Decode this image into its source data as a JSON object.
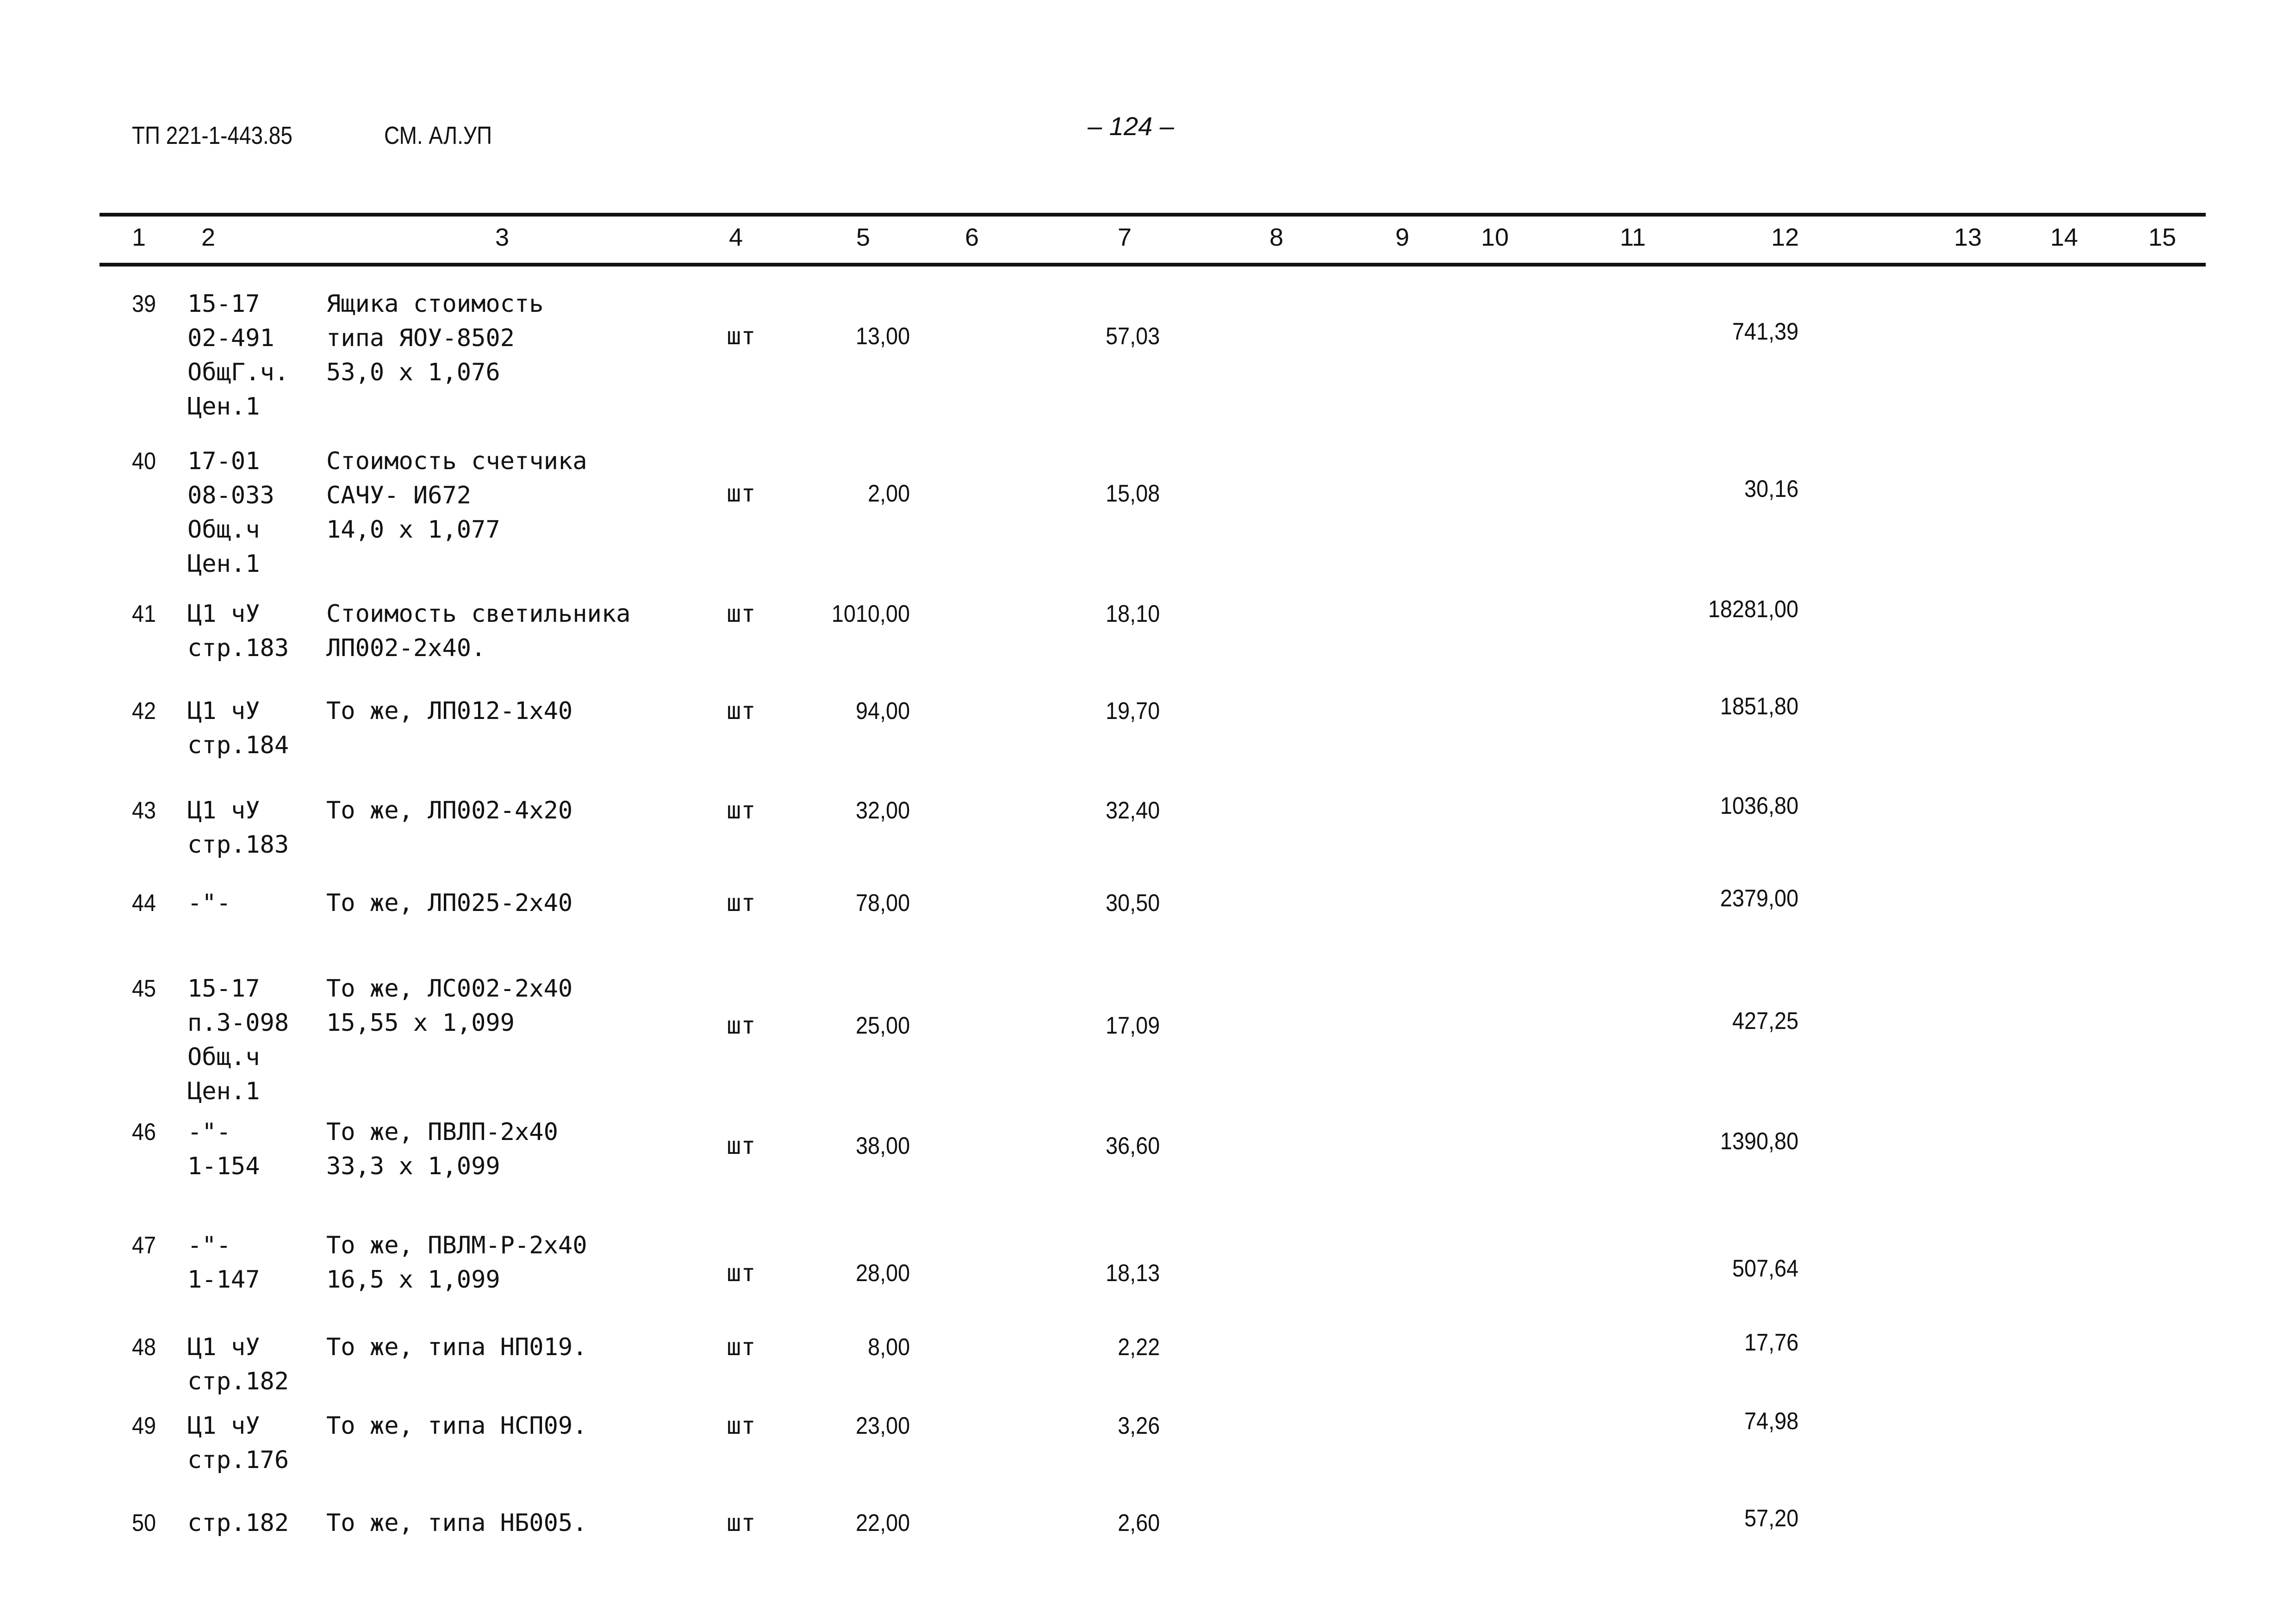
{
  "header": {
    "doc_code": "ТП 221-1-443.85",
    "sheet_ref": "СМ. АЛ.УП",
    "page_number": "– 124 –"
  },
  "columns": [
    "1",
    "2",
    "3",
    "4",
    "5",
    "6",
    "7",
    "8",
    "9",
    "10",
    "11",
    "12",
    "13",
    "14",
    "15"
  ],
  "rows": [
    {
      "no": "39",
      "code": [
        "15-17",
        "02-491",
        "ОбщГ.ч.",
        "Цен.1"
      ],
      "name": [
        "Ящика стоимость",
        "типа ЯОУ-8502",
        "53,0 х 1,076"
      ],
      "unit": "шт",
      "qty": "13,00",
      "price": "57,03",
      "total": "741,39"
    },
    {
      "no": "40",
      "code": [
        "17-01",
        "08-033",
        "Общ.ч",
        "Цен.1"
      ],
      "name": [
        "Стоимость счетчика",
        "САЧУ- И672",
        "14,0 х 1,077"
      ],
      "unit": "шт",
      "qty": "2,00",
      "price": "15,08",
      "total": "30,16"
    },
    {
      "no": "41",
      "code": [
        "Ц1 чУ",
        "стр.183"
      ],
      "name": [
        "Стоимость светильника",
        "ЛП002-2х40."
      ],
      "unit": "шт",
      "qty": "1010,00",
      "price": "18,10",
      "total": "18281,00"
    },
    {
      "no": "42",
      "code": [
        "Ц1 чУ",
        "стр.184"
      ],
      "name": [
        "То же, ЛП012-1х40"
      ],
      "unit": "шт",
      "qty": "94,00",
      "price": "19,70",
      "total": "1851,80"
    },
    {
      "no": "43",
      "code": [
        "Ц1 чУ",
        "стр.183"
      ],
      "name": [
        "То же, ЛП002-4х20"
      ],
      "unit": "шт",
      "qty": "32,00",
      "price": "32,40",
      "total": "1036,80"
    },
    {
      "no": "44",
      "code": [
        "-\"-"
      ],
      "name": [
        "То же, ЛП025-2х40"
      ],
      "unit": "шт",
      "qty": "78,00",
      "price": "30,50",
      "total": "2379,00"
    },
    {
      "no": "45",
      "code": [
        "15-17",
        "п.3-098",
        "Общ.ч",
        "Цен.1"
      ],
      "name": [
        "То же, ЛС002-2х40",
        "15,55 х 1,099"
      ],
      "unit": "шт",
      "qty": "25,00",
      "price": "17,09",
      "total": "427,25"
    },
    {
      "no": "46",
      "code": [
        "-\"-",
        "1-154"
      ],
      "name": [
        "То же, ПВЛП-2х40",
        "33,3 х 1,099"
      ],
      "unit": "шт",
      "qty": "38,00",
      "price": "36,60",
      "total": "1390,80"
    },
    {
      "no": "47",
      "code": [
        "-\"-",
        "1-147"
      ],
      "name": [
        "То же, ПВЛМ-Р-2х40",
        "16,5 х 1,099"
      ],
      "unit": "шт",
      "qty": "28,00",
      "price": "18,13",
      "total": "507,64"
    },
    {
      "no": "48",
      "code": [
        "Ц1 чУ",
        "стр.182"
      ],
      "name": [
        "То же, типа НП019."
      ],
      "unit": "шт",
      "qty": "8,00",
      "price": "2,22",
      "total": "17,76"
    },
    {
      "no": "49",
      "code": [
        "Ц1 чУ",
        "стр.176"
      ],
      "name": [
        "То же, типа НСП09."
      ],
      "unit": "шт",
      "qty": "23,00",
      "price": "3,26",
      "total": "74,98"
    },
    {
      "no": "50",
      "code": [
        "стр.182"
      ],
      "name": [
        "То же, типа НБ005."
      ],
      "unit": "шт",
      "qty": "22,00",
      "price": "2,60",
      "total": "57,20"
    }
  ]
}
